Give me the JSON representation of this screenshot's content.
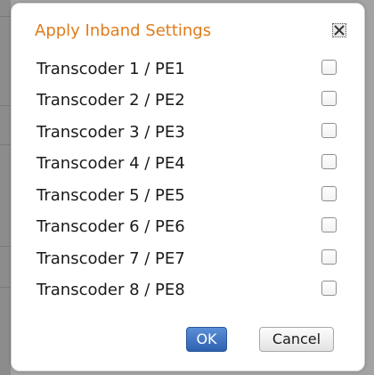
{
  "dialog": {
    "title": "Apply Inband Settings",
    "ok_label": "OK",
    "cancel_label": "Cancel",
    "items": [
      {
        "label": "Transcoder 1 / PE1",
        "checked": false
      },
      {
        "label": "Transcoder 2 / PE2",
        "checked": false
      },
      {
        "label": "Transcoder 3 / PE3",
        "checked": false
      },
      {
        "label": "Transcoder 4 / PE4",
        "checked": false
      },
      {
        "label": "Transcoder 5 / PE5",
        "checked": false
      },
      {
        "label": "Transcoder 6 / PE6",
        "checked": false
      },
      {
        "label": "Transcoder 7 / PE7",
        "checked": false
      },
      {
        "label": "Transcoder 8 / PE8",
        "checked": false
      }
    ]
  },
  "colors": {
    "title": "#e07b1a",
    "ok_button": "#2e61b0"
  },
  "icons": {
    "close": "close-icon"
  }
}
